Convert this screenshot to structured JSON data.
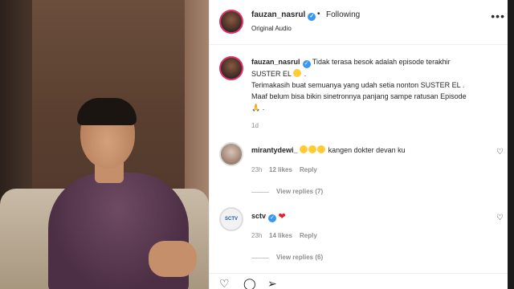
{
  "header": {
    "username": "fauzan_nasrul",
    "separator": "•",
    "follow_state": "Following",
    "audio": "Original Audio",
    "more_icon": "more-horizontal-icon"
  },
  "caption": {
    "username": "fauzan_nasrul",
    "line1": "Tidak terasa besok adalah episode terakhir",
    "line2": "SUSTER EL",
    "line2_suffix": ".",
    "line3": "Terimakasih buat semuanya yang udah setia nonton SUSTER EL .",
    "line4": "Maaf belum bisa bikin sinetronnya panjang sampe ratusan Episode",
    "line5": ".",
    "time": "1d"
  },
  "comments": [
    {
      "username": "mirantydewi_",
      "text": "kangen dokter devan ku",
      "time": "23h",
      "likes": "12 likes",
      "reply": "Reply",
      "view_replies": "View replies (7)"
    },
    {
      "username": "sctv",
      "avatar_text": "SCTV",
      "text": "",
      "time": "23h",
      "likes": "14 likes",
      "reply": "Reply",
      "view_replies": "View replies (6)"
    }
  ],
  "colors": {
    "verified": "#3897f0",
    "story_ring": "#e1306c",
    "muted": "#8e8e8e"
  }
}
